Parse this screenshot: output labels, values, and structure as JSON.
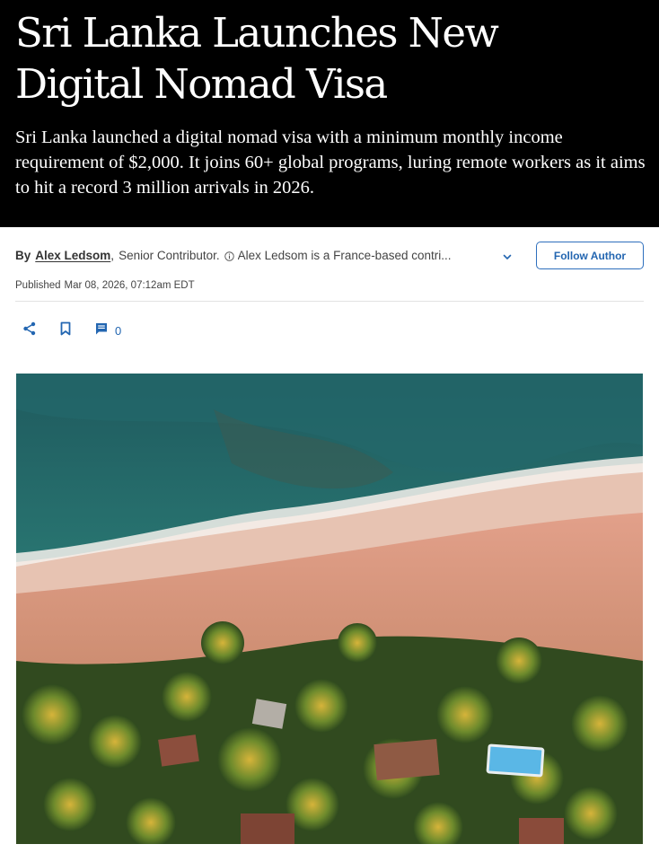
{
  "article": {
    "headline": "Sri Lanka Launches New Digital Nomad Visa",
    "dek": "Sri Lanka launched a digital nomad visa with a minimum monthly income requirement of $2,000. It joins 60+ global programs, luring remote workers as it aims to hit a record 3 million arrivals in 2026."
  },
  "byline": {
    "by_label": "By",
    "author_name": "Alex Ledsom",
    "author_title": "Senior Contributor.",
    "author_bio": "Alex Ledsom is a France-based contri...",
    "follow_label": "Follow Author"
  },
  "meta": {
    "published_label": "Published",
    "published_date": "Mar 08, 2026, 07:12am EDT"
  },
  "toolbar": {
    "share_icon": "share-icon",
    "bookmark_icon": "bookmark-icon",
    "comment_icon": "comment-icon",
    "comment_count": "0"
  },
  "colors": {
    "accent": "#2366b1",
    "hero_background": "#000000"
  },
  "hero_image": {
    "alt": "Aerial view of a tropical beach with turquoise sea, sand, palm trees and a swimming pool"
  }
}
